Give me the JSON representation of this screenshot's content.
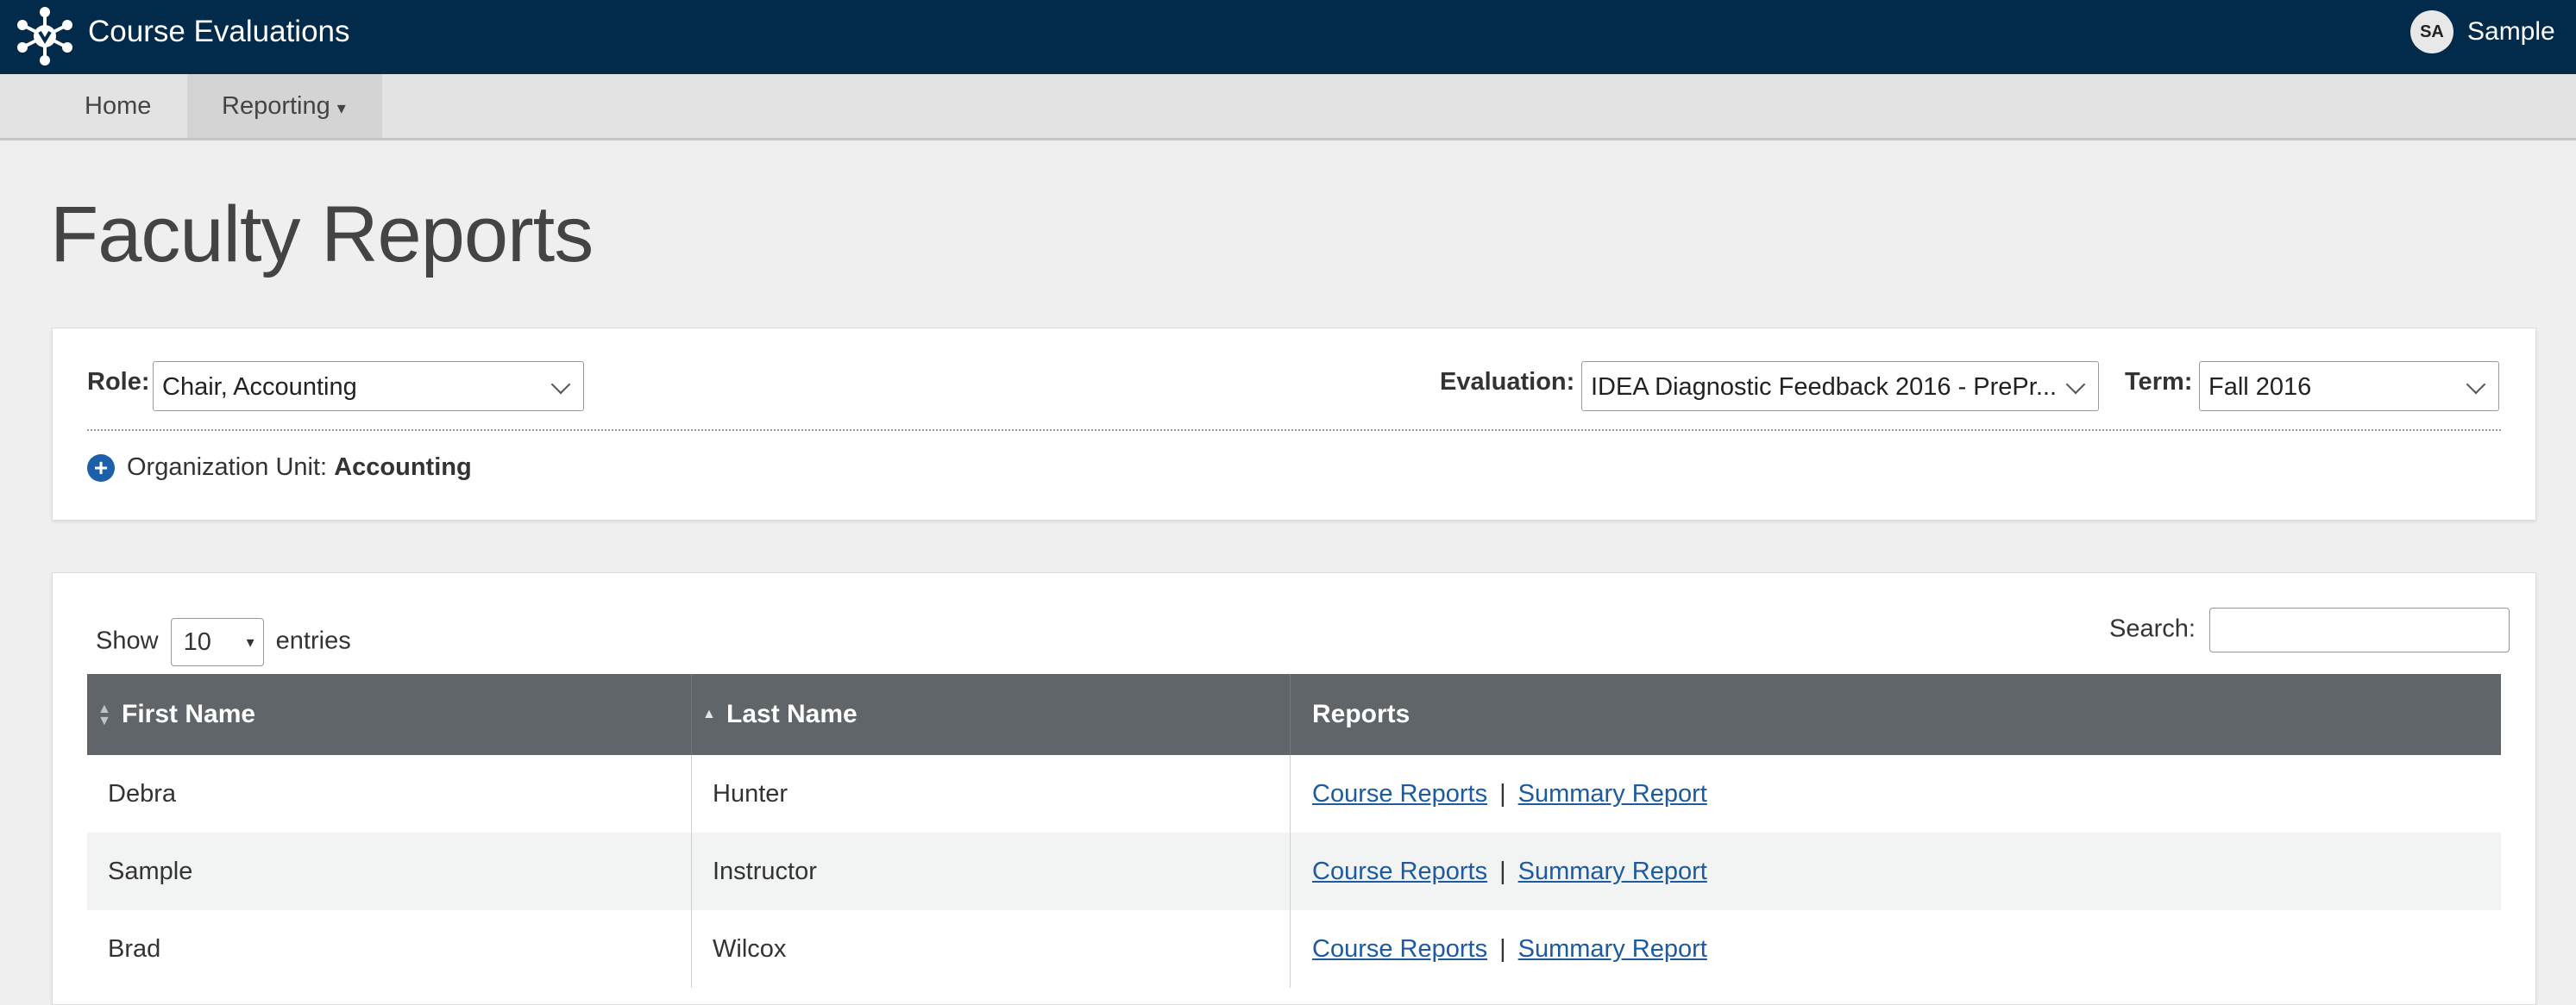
{
  "header": {
    "app_title": "Course Evaluations",
    "avatar_initials": "SA",
    "user_name": "Sample",
    "background_color": "#022a4a"
  },
  "nav": {
    "home": "Home",
    "reporting": "Reporting",
    "reporting_caret": "▾"
  },
  "page": {
    "title": "Faculty Reports"
  },
  "filters": {
    "role_label": "Role:",
    "role_value": "Chair, Accounting",
    "evaluation_label": "Evaluation:",
    "evaluation_value": "IDEA Diagnostic Feedback 2016 - PrePr...",
    "term_label": "Term:",
    "term_value": "Fall 2016",
    "org_unit_label": "Organization Unit:",
    "org_unit_value": "Accounting"
  },
  "table_controls": {
    "show_label": "Show",
    "page_size": "10",
    "entries_label": "entries",
    "search_label": "Search:",
    "search_value": ""
  },
  "table": {
    "columns": [
      "First Name",
      "Last Name",
      "Reports"
    ],
    "rows": [
      {
        "first": "Debra",
        "last": "Hunter",
        "course_reports": "Course Reports",
        "summary_report": "Summary Report"
      },
      {
        "first": "Sample",
        "last": "Instructor",
        "course_reports": "Course Reports",
        "summary_report": "Summary Report"
      },
      {
        "first": "Brad",
        "last": "Wilcox",
        "course_reports": "Course Reports",
        "summary_report": "Summary Report"
      }
    ],
    "separator": "|"
  },
  "colors": {
    "link": "#1d5aa0",
    "table_header": "#5f6569",
    "accent_icon": "#1d5fa8"
  }
}
